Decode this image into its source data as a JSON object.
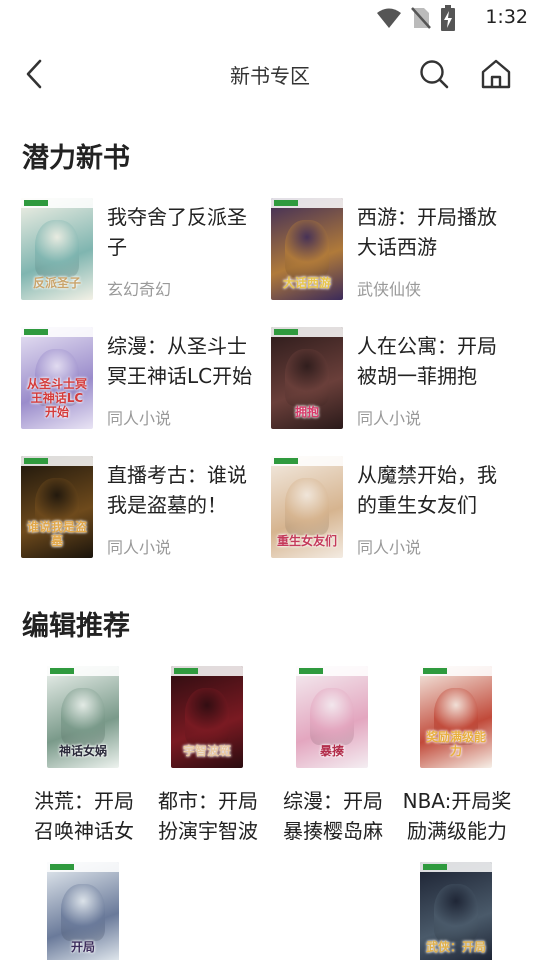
{
  "status_bar": {
    "time": "1:32"
  },
  "header": {
    "title": "新书专区"
  },
  "potential": {
    "title": "潜力新书",
    "books": [
      {
        "name": "我夺舍了反派圣子",
        "genre": "玄幻奇幻",
        "cover_text": "反派圣子",
        "cover_colors": [
          "#f4f1e6",
          "#7fb5b0",
          "#c9a46b"
        ]
      },
      {
        "name": "西游：开局播放大话西游",
        "genre": "武侠仙侠",
        "cover_text": "大话西游",
        "cover_colors": [
          "#3b2a5a",
          "#b07a3a",
          "#e8c54a"
        ]
      },
      {
        "name": "综漫：从圣斗士冥王神话LC开始",
        "genre": "同人小说",
        "cover_text": "从圣斗士冥王神话LC开始",
        "cover_colors": [
          "#e9e4f4",
          "#9a8ccb",
          "#d43b3b"
        ]
      },
      {
        "name": "人在公寓：开局被胡一菲拥抱",
        "genre": "同人小说",
        "cover_text": "拥抱",
        "cover_colors": [
          "#2a1a1a",
          "#6a3f3a",
          "#d83a6a"
        ]
      },
      {
        "name": "直播考古：谁说我是盗墓的！",
        "genre": "同人小说",
        "cover_text": "谁说我是盗墓",
        "cover_colors": [
          "#1a140c",
          "#6e4a1c",
          "#e2a84a"
        ]
      },
      {
        "name": "从魔禁开始，我的重生女友们",
        "genre": "同人小说",
        "cover_text": "重生女友们",
        "cover_colors": [
          "#f3ebe2",
          "#d6b48f",
          "#c43a5a"
        ]
      }
    ]
  },
  "editor": {
    "title": "编辑推荐",
    "books": [
      {
        "name": "洪荒：开局召唤神话女",
        "cover_text": "神话女娲",
        "cover_colors": [
          "#eef3ef",
          "#7a9a8a",
          "#2a2a3a"
        ]
      },
      {
        "name": "都市：开局扮演宇智波",
        "cover_text": "宇智波斑",
        "cover_colors": [
          "#2a0c10",
          "#7a1a22",
          "#e8c8a0"
        ]
      },
      {
        "name": "综漫：开局暴揍樱岛麻",
        "cover_text": "暴揍",
        "cover_colors": [
          "#f4eef2",
          "#e3a6bf",
          "#b22c4a"
        ]
      },
      {
        "name": "NBA:开局奖励满级能力",
        "cover_text": "奖励满级能力",
        "cover_colors": [
          "#f6f0e8",
          "#c14a3a",
          "#e8b040"
        ]
      },
      {
        "name": "",
        "cover_text": "开局",
        "cover_colors": [
          "#e8eef2",
          "#6a7a9a",
          "#3a2a5a"
        ]
      },
      {
        "name": "",
        "cover_text": "武侠：开局",
        "cover_colors": [
          "#1a2030",
          "#4a5a6a",
          "#e0b04a"
        ]
      }
    ]
  }
}
